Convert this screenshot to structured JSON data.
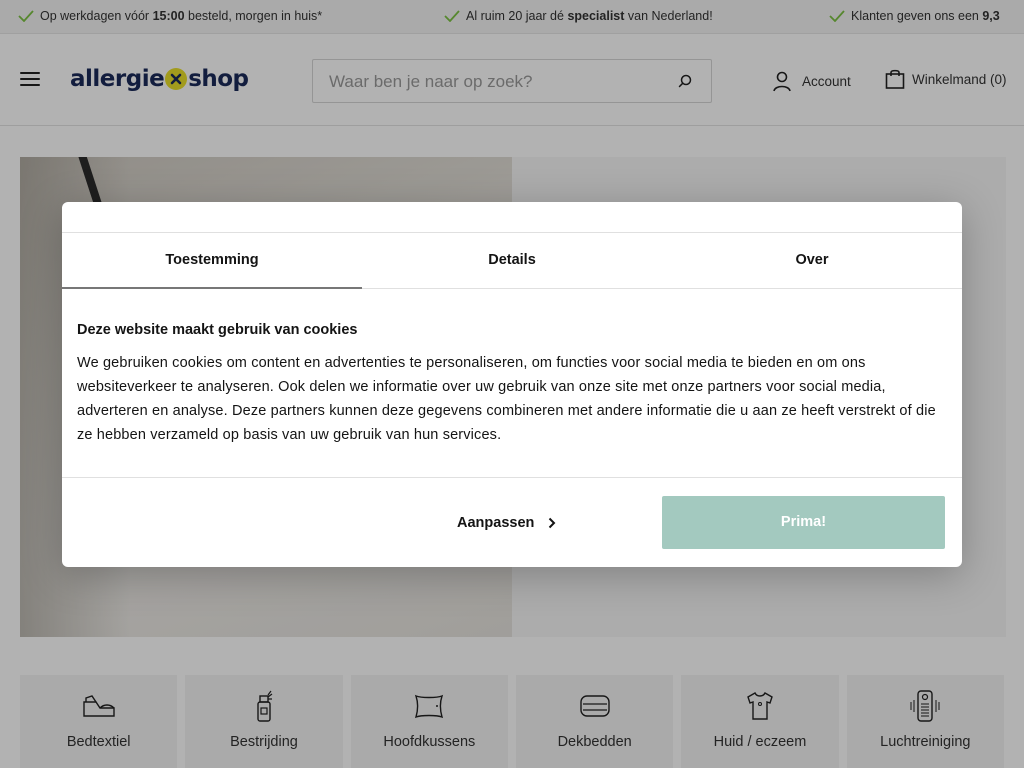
{
  "usp": [
    {
      "pre": "Op werkdagen vóór ",
      "bold": "15:00",
      "post": " besteld, morgen in huis*"
    },
    {
      "pre": "Al ruim 20 jaar dé ",
      "bold": "specialist",
      "post": " van Nederland!"
    },
    {
      "pre": "Klanten geven ons een ",
      "bold": "9,3",
      "post": ""
    }
  ],
  "header": {
    "logo_left": "allergie",
    "logo_right": "shop",
    "search_placeholder": "Waar ben je naar op zoek?",
    "account_label": "Account",
    "cart_label": "Winkelmand (0)"
  },
  "categories": [
    {
      "label": "Bedtextiel",
      "icon": "bed-textile-icon"
    },
    {
      "label": "Bestrijding",
      "icon": "spray-bottle-icon"
    },
    {
      "label": "Hoofdkussens",
      "icon": "pillow-icon"
    },
    {
      "label": "Dekbedden",
      "icon": "duvet-icon"
    },
    {
      "label": "Huid / eczeem",
      "icon": "shirt-icon"
    },
    {
      "label": "Luchtreiniging",
      "icon": "air-purifier-icon"
    }
  ],
  "cookie_dialog": {
    "tabs": [
      "Toestemming",
      "Details",
      "Over"
    ],
    "active_tab": "Toestemming",
    "title": "Deze website maakt gebruik van cookies",
    "text": "We gebruiken cookies om content en advertenties te personaliseren, om functies voor social media te bieden en om ons websiteverkeer te analyseren. Ook delen we informatie over uw gebruik van onze site met onze partners voor social media, adverteren en analyse. Deze partners kunnen deze gegevens combineren met andere informatie die u aan ze heeft verstrekt of die ze hebben verzameld op basis van uw gebruik van hun services.",
    "customize_label": "Aanpassen",
    "accept_label": "Prima!"
  },
  "colors": {
    "accent_check": "#7cc242",
    "logo_navy": "#1b2a5a",
    "logo_yellow": "#e8df2a",
    "accept_button": "#a3c9bf"
  }
}
